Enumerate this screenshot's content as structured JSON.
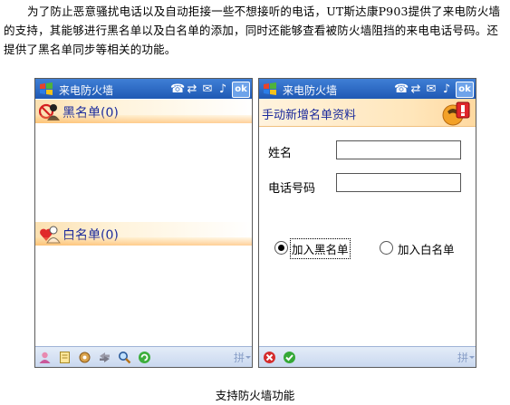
{
  "article": {
    "paragraph": "为了防止恶意骚扰电话以及自动拒接一些不想接听的电话，UT斯达康P903提供了来电防火墙的支持，其能够进行黑名单以及白名单的添加，同时还能够查看被防火墙阻挡的来电电话号码。还提供了黑名单同步等相关的功能。",
    "caption": "支持防火墙功能"
  },
  "left_screen": {
    "title": "来电防火墙",
    "ok_label": "ok",
    "blacklist_label": "黑名单(0)",
    "whitelist_label": "白名单(0)",
    "input_method": "拼",
    "bottom_icons": [
      "contact-icon",
      "note-icon",
      "settings-icon",
      "sync-icon",
      "find-icon",
      "refresh-icon"
    ]
  },
  "right_screen": {
    "title": "来电防火墙",
    "ok_label": "ok",
    "form_title": "手动新增名单资料",
    "name_label": "姓名",
    "name_value": "",
    "phone_label": "电话号码",
    "phone_value": "",
    "option_black": "加入黑名单",
    "option_white": "加入白名单",
    "selected_option": "black",
    "input_method": "拼",
    "bottom_icons": [
      "cancel-icon",
      "confirm-icon"
    ]
  },
  "colors": {
    "titlebar": "#2a66c2",
    "list_text": "#1a2a9c",
    "flame": "#ffb060"
  }
}
